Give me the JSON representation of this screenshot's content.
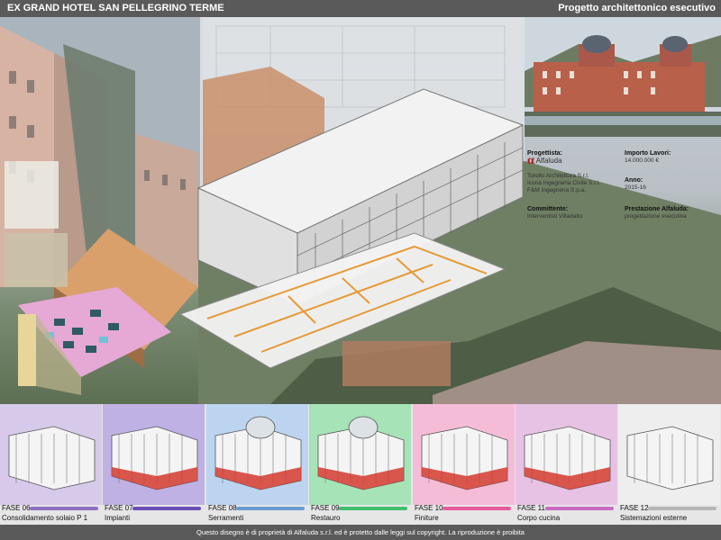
{
  "header": {
    "title": "EX GRAND HOTEL SAN PELLEGRINO TERME",
    "subtitle": "Progetto architettonico esecutivo"
  },
  "info": {
    "progettista_label": "Progettista:",
    "progettista_logo": "Alfaluda",
    "progettisti": [
      "Torello Architettura S.r.l.",
      "Icona Ingegneria Civile S.r.l.",
      "F&M Ingegneria S.p.a."
    ],
    "importo_label": "Importo Lavori:",
    "importo_value": "14.000.000 €",
    "anno_label": "Anno:",
    "anno_value": "2015-16",
    "committente_label": "Committente:",
    "committente_value": "Interventisti Villadalto",
    "prestazione_label": "Prestazione Alfaluda:",
    "prestazione_value": "progettazione esecutiva"
  },
  "phases": [
    {
      "code": "FASE 06",
      "name": "Consolidamento solaio P 1",
      "color": "#8e6fc0",
      "tint": "#d7c9ea"
    },
    {
      "code": "FASE 07",
      "name": "Impianti",
      "color": "#6a4fb5",
      "tint": "#bfb1e3"
    },
    {
      "code": "FASE 08",
      "name": "Serramenti",
      "color": "#6b9bd3",
      "tint": "#bcd4ef"
    },
    {
      "code": "FASE 09",
      "name": "Restauro",
      "color": "#3fbf6a",
      "tint": "#a6e3b7"
    },
    {
      "code": "FASE 10",
      "name": "Finiture",
      "color": "#e85b9f",
      "tint": "#f5bcd8"
    },
    {
      "code": "FASE 11",
      "name": "Corpo cucina",
      "color": "#c86bc2",
      "tint": "#e7c2e4"
    },
    {
      "code": "FASE 12",
      "name": "Sistemazioni esterne",
      "color": "#b5b5b5",
      "tint": "#eeeeee"
    }
  ],
  "footer": {
    "notice": "Questo disegno è di proprietà di Alfaluda s.r.l. ed è protetto dalle leggi sul copyright.  La riproduzione è proibita"
  }
}
